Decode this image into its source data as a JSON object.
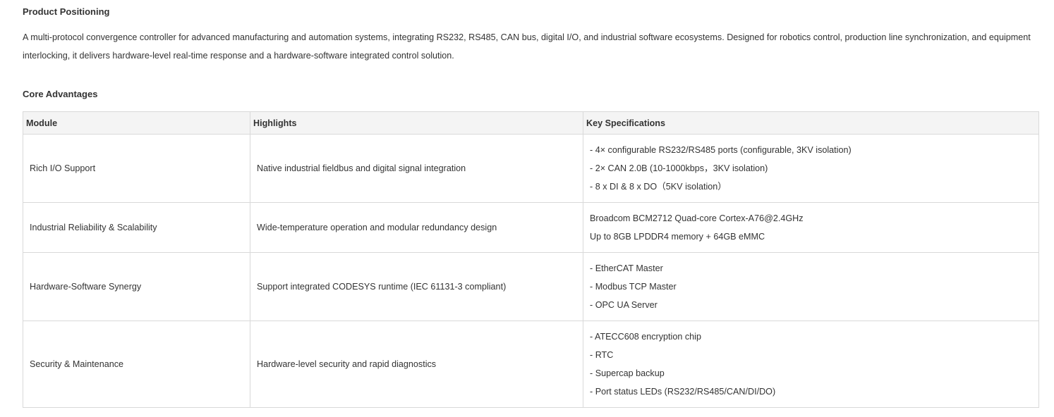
{
  "positioning": {
    "title": "Product Positioning",
    "text": "A multi-protocol convergence controller for advanced manufacturing and automation systems, integrating RS232, RS485, CAN bus, digital I/O, and industrial software ecosystems. Designed for robotics control, production line synchronization, and equipment interlocking, it delivers hardware-level real-time response and a hardware-software integrated control solution."
  },
  "advantages": {
    "title": "Core Advantages",
    "headers": [
      "Module",
      "Highlights",
      "Key Specifications"
    ],
    "rows": [
      {
        "module": "Rich I/O Support",
        "highlight": "Native industrial fieldbus and digital signal integration",
        "specs": [
          "- 4× configurable RS232/RS485 ports (configurable, 3KV isolation)",
          "- 2× CAN 2.0B (10-1000kbps，3KV isolation)",
          "- 8 x DI & 8 x DO（5KV isolation）"
        ]
      },
      {
        "module": "Industrial Reliability & Scalability",
        "highlight": "Wide-temperature operation and modular redundancy design",
        "specs": [
          "Broadcom BCM2712 Quad-core Cortex-A76@2.4GHz",
          "Up to 8GB LPDDR4 memory + 64GB eMMC"
        ]
      },
      {
        "module": "Hardware-Software Synergy",
        "highlight": "Support integrated CODESYS runtime (IEC 61131-3 compliant)",
        "specs": [
          "- EtherCAT Master",
          "- Modbus TCP Master",
          "- OPC UA Server"
        ]
      },
      {
        "module": "Security & Maintenance",
        "highlight": "Hardware-level security and rapid diagnostics",
        "specs": [
          "- ATECC608 encryption chip",
          "- RTC",
          "- Supercap backup",
          "- Port status LEDs (RS232/RS485/CAN/DI/DO)"
        ]
      }
    ]
  }
}
